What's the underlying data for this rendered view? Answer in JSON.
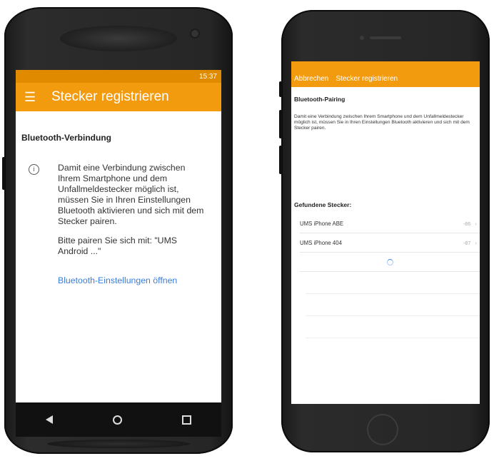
{
  "android": {
    "status": {
      "left": "",
      "right": "15:37"
    },
    "app_bar": {
      "menu_icon": "hamburger-icon",
      "title": "Stecker registrieren"
    },
    "section_title": "Bluetooth-Verbindung",
    "info_icon": "info-icon",
    "info_text": "Damit eine Verbindung zwischen Ihrem Smartphone und dem Unfallmeldestecker möglich ist, müssen Sie in Ihren Einstellungen Bluetooth aktivieren und sich mit dem Stecker pairen.",
    "pair_text": "Bitte pairen Sie sich mit: \"UMS Android ...\"",
    "settings_link": "Bluetooth-Einstellungen öffnen",
    "nav": {
      "back_icon": "back-triangle-icon",
      "home_icon": "home-circle-icon",
      "recent_icon": "recents-square-icon"
    },
    "colors": {
      "accent": "#f39b0f",
      "status_bar": "#e08a00",
      "link": "#3b7dd8"
    }
  },
  "iphone": {
    "status": {
      "left": "",
      "time": "",
      "right": ""
    },
    "nav": {
      "cancel_label": "Abbrechen",
      "title": "Stecker registrieren"
    },
    "heading": "Bluetooth-Pairing",
    "description": "Damit eine Verbindung zwischen Ihrem Smartphone und dem Unfallmeldestecker möglich ist, müssen Sie in Ihren Einstellungen Bluetooth aktivieren und sich mit dem Stecker pairen.",
    "found_heading": "Gefundene Stecker:",
    "devices": [
      {
        "name": "UMS iPhone ABE",
        "signal": "-86"
      },
      {
        "name": "UMS iPhone 404",
        "signal": "-87"
      }
    ],
    "spinner_icon": "loading-spinner-icon",
    "colors": {
      "accent": "#f39b0f"
    }
  }
}
